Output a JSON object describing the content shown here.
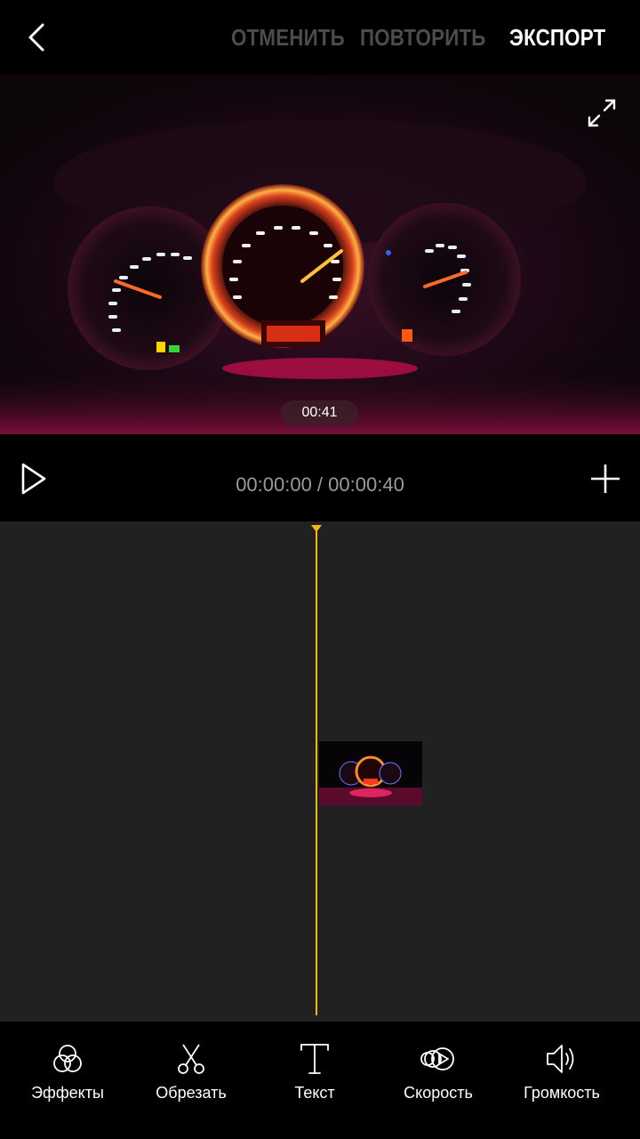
{
  "topbar": {
    "undo_label": "ОТМЕНИТЬ",
    "redo_label": "ПОВТОРИТЬ",
    "export_label": "ЭКСПОРТ"
  },
  "preview": {
    "clip_duration": "00:41"
  },
  "playback": {
    "timecode": "00:00:00 / 00:00:40"
  },
  "toolbar": {
    "items": [
      {
        "label": "Эффекты",
        "icon": "effects-icon"
      },
      {
        "label": "Обрезать",
        "icon": "scissors-icon"
      },
      {
        "label": "Текст",
        "icon": "text-icon"
      },
      {
        "label": "Скорость",
        "icon": "speed-icon"
      },
      {
        "label": "Громкость",
        "icon": "volume-icon"
      }
    ]
  },
  "colors": {
    "accent": "#f3b81e",
    "inactive_action": "#4c4c4c",
    "timeline_bg": "#212121"
  }
}
